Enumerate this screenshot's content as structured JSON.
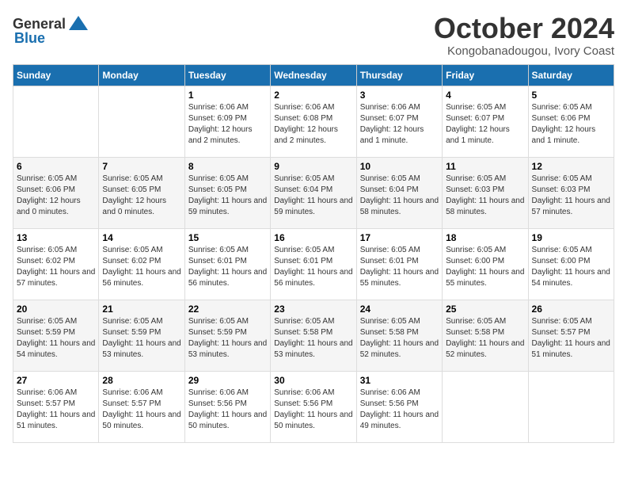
{
  "header": {
    "logo_general": "General",
    "logo_blue": "Blue",
    "month": "October 2024",
    "location": "Kongobanadougou, Ivory Coast"
  },
  "weekdays": [
    "Sunday",
    "Monday",
    "Tuesday",
    "Wednesday",
    "Thursday",
    "Friday",
    "Saturday"
  ],
  "weeks": [
    [
      {
        "day": "",
        "sunrise": "",
        "sunset": "",
        "daylight": ""
      },
      {
        "day": "",
        "sunrise": "",
        "sunset": "",
        "daylight": ""
      },
      {
        "day": "1",
        "sunrise": "Sunrise: 6:06 AM",
        "sunset": "Sunset: 6:09 PM",
        "daylight": "Daylight: 12 hours and 2 minutes."
      },
      {
        "day": "2",
        "sunrise": "Sunrise: 6:06 AM",
        "sunset": "Sunset: 6:08 PM",
        "daylight": "Daylight: 12 hours and 2 minutes."
      },
      {
        "day": "3",
        "sunrise": "Sunrise: 6:06 AM",
        "sunset": "Sunset: 6:07 PM",
        "daylight": "Daylight: 12 hours and 1 minute."
      },
      {
        "day": "4",
        "sunrise": "Sunrise: 6:05 AM",
        "sunset": "Sunset: 6:07 PM",
        "daylight": "Daylight: 12 hours and 1 minute."
      },
      {
        "day": "5",
        "sunrise": "Sunrise: 6:05 AM",
        "sunset": "Sunset: 6:06 PM",
        "daylight": "Daylight: 12 hours and 1 minute."
      }
    ],
    [
      {
        "day": "6",
        "sunrise": "Sunrise: 6:05 AM",
        "sunset": "Sunset: 6:06 PM",
        "daylight": "Daylight: 12 hours and 0 minutes."
      },
      {
        "day": "7",
        "sunrise": "Sunrise: 6:05 AM",
        "sunset": "Sunset: 6:05 PM",
        "daylight": "Daylight: 12 hours and 0 minutes."
      },
      {
        "day": "8",
        "sunrise": "Sunrise: 6:05 AM",
        "sunset": "Sunset: 6:05 PM",
        "daylight": "Daylight: 11 hours and 59 minutes."
      },
      {
        "day": "9",
        "sunrise": "Sunrise: 6:05 AM",
        "sunset": "Sunset: 6:04 PM",
        "daylight": "Daylight: 11 hours and 59 minutes."
      },
      {
        "day": "10",
        "sunrise": "Sunrise: 6:05 AM",
        "sunset": "Sunset: 6:04 PM",
        "daylight": "Daylight: 11 hours and 58 minutes."
      },
      {
        "day": "11",
        "sunrise": "Sunrise: 6:05 AM",
        "sunset": "Sunset: 6:03 PM",
        "daylight": "Daylight: 11 hours and 58 minutes."
      },
      {
        "day": "12",
        "sunrise": "Sunrise: 6:05 AM",
        "sunset": "Sunset: 6:03 PM",
        "daylight": "Daylight: 11 hours and 57 minutes."
      }
    ],
    [
      {
        "day": "13",
        "sunrise": "Sunrise: 6:05 AM",
        "sunset": "Sunset: 6:02 PM",
        "daylight": "Daylight: 11 hours and 57 minutes."
      },
      {
        "day": "14",
        "sunrise": "Sunrise: 6:05 AM",
        "sunset": "Sunset: 6:02 PM",
        "daylight": "Daylight: 11 hours and 56 minutes."
      },
      {
        "day": "15",
        "sunrise": "Sunrise: 6:05 AM",
        "sunset": "Sunset: 6:01 PM",
        "daylight": "Daylight: 11 hours and 56 minutes."
      },
      {
        "day": "16",
        "sunrise": "Sunrise: 6:05 AM",
        "sunset": "Sunset: 6:01 PM",
        "daylight": "Daylight: 11 hours and 56 minutes."
      },
      {
        "day": "17",
        "sunrise": "Sunrise: 6:05 AM",
        "sunset": "Sunset: 6:01 PM",
        "daylight": "Daylight: 11 hours and 55 minutes."
      },
      {
        "day": "18",
        "sunrise": "Sunrise: 6:05 AM",
        "sunset": "Sunset: 6:00 PM",
        "daylight": "Daylight: 11 hours and 55 minutes."
      },
      {
        "day": "19",
        "sunrise": "Sunrise: 6:05 AM",
        "sunset": "Sunset: 6:00 PM",
        "daylight": "Daylight: 11 hours and 54 minutes."
      }
    ],
    [
      {
        "day": "20",
        "sunrise": "Sunrise: 6:05 AM",
        "sunset": "Sunset: 5:59 PM",
        "daylight": "Daylight: 11 hours and 54 minutes."
      },
      {
        "day": "21",
        "sunrise": "Sunrise: 6:05 AM",
        "sunset": "Sunset: 5:59 PM",
        "daylight": "Daylight: 11 hours and 53 minutes."
      },
      {
        "day": "22",
        "sunrise": "Sunrise: 6:05 AM",
        "sunset": "Sunset: 5:59 PM",
        "daylight": "Daylight: 11 hours and 53 minutes."
      },
      {
        "day": "23",
        "sunrise": "Sunrise: 6:05 AM",
        "sunset": "Sunset: 5:58 PM",
        "daylight": "Daylight: 11 hours and 53 minutes."
      },
      {
        "day": "24",
        "sunrise": "Sunrise: 6:05 AM",
        "sunset": "Sunset: 5:58 PM",
        "daylight": "Daylight: 11 hours and 52 minutes."
      },
      {
        "day": "25",
        "sunrise": "Sunrise: 6:05 AM",
        "sunset": "Sunset: 5:58 PM",
        "daylight": "Daylight: 11 hours and 52 minutes."
      },
      {
        "day": "26",
        "sunrise": "Sunrise: 6:05 AM",
        "sunset": "Sunset: 5:57 PM",
        "daylight": "Daylight: 11 hours and 51 minutes."
      }
    ],
    [
      {
        "day": "27",
        "sunrise": "Sunrise: 6:06 AM",
        "sunset": "Sunset: 5:57 PM",
        "daylight": "Daylight: 11 hours and 51 minutes."
      },
      {
        "day": "28",
        "sunrise": "Sunrise: 6:06 AM",
        "sunset": "Sunset: 5:57 PM",
        "daylight": "Daylight: 11 hours and 50 minutes."
      },
      {
        "day": "29",
        "sunrise": "Sunrise: 6:06 AM",
        "sunset": "Sunset: 5:56 PM",
        "daylight": "Daylight: 11 hours and 50 minutes."
      },
      {
        "day": "30",
        "sunrise": "Sunrise: 6:06 AM",
        "sunset": "Sunset: 5:56 PM",
        "daylight": "Daylight: 11 hours and 50 minutes."
      },
      {
        "day": "31",
        "sunrise": "Sunrise: 6:06 AM",
        "sunset": "Sunset: 5:56 PM",
        "daylight": "Daylight: 11 hours and 49 minutes."
      },
      {
        "day": "",
        "sunrise": "",
        "sunset": "",
        "daylight": ""
      },
      {
        "day": "",
        "sunrise": "",
        "sunset": "",
        "daylight": ""
      }
    ]
  ]
}
